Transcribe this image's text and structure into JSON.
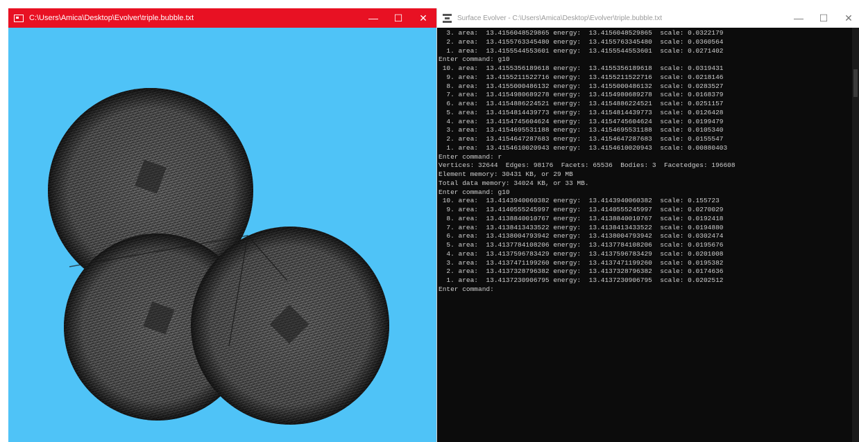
{
  "graphics_window": {
    "title": "C:\\Users\\Amica\\Desktop\\Evolver\\triple.bubble.txt",
    "background": "#4fc3f7",
    "titlebar_color": "#e81123",
    "controls": {
      "minimize": "—",
      "maximize": "☐",
      "close": "✕"
    }
  },
  "console_window": {
    "title": "Surface Evolver - C:\\Users\\Amica\\Desktop\\Evolver\\triple.bubble.txt",
    "controls": {
      "minimize": "—",
      "maximize": "☐",
      "close": "✕"
    },
    "lines": [
      "  3. area:  13.4156048529865 energy:  13.4156048529865  scale: 0.0322179",
      "  2. area:  13.4155763345480 energy:  13.4155763345480  scale: 0.0360564",
      "  1. area:  13.4155544553601 energy:  13.4155544553601  scale: 0.0271402",
      "Enter command: g10",
      " 10. area:  13.4155356189618 energy:  13.4155356189618  scale: 0.0319431",
      "  9. area:  13.4155211522716 energy:  13.4155211522716  scale: 0.0218146",
      "  8. area:  13.4155000486132 energy:  13.4155000486132  scale: 0.0283527",
      "  7. area:  13.4154980689278 energy:  13.4154980689278  scale: 0.0168379",
      "  6. area:  13.4154886224521 energy:  13.4154886224521  scale: 0.0251157",
      "  5. area:  13.4154814439773 energy:  13.4154814439773  scale: 0.0126428",
      "  4. area:  13.4154745604624 energy:  13.4154745604624  scale: 0.0199479",
      "  3. area:  13.4154695531188 energy:  13.4154695531188  scale: 0.0105340",
      "  2. area:  13.4154647287683 energy:  13.4154647287683  scale: 0.0155547",
      "  1. area:  13.4154610020943 energy:  13.4154610020943  scale: 0.00880403",
      "Enter command: r",
      "Vertices: 32644  Edges: 98176  Facets: 65536  Bodies: 3  Facetedges: 196608",
      "Element memory: 30431 KB, or 29 MB",
      "Total data memory: 34024 KB, or 33 MB.",
      "Enter command: g10",
      " 10. area:  13.4143940060382 energy:  13.4143940060382  scale: 0.155723",
      "  9. area:  13.4140555245997 energy:  13.4140555245997  scale: 0.0270029",
      "  8. area:  13.4138840010767 energy:  13.4138840010767  scale: 0.0192418",
      "  7. area:  13.4138413433522 energy:  13.4138413433522  scale: 0.0194880",
      "  6. area:  13.4138004793942 energy:  13.4138004793942  scale: 0.0302474",
      "  5. area:  13.4137784108206 energy:  13.4137784108206  scale: 0.0195676",
      "  4. area:  13.4137596783429 energy:  13.4137596783429  scale: 0.0201008",
      "  3. area:  13.4137471199260 energy:  13.4137471199260  scale: 0.0195382",
      "  2. area:  13.4137328796382 energy:  13.4137328796382  scale: 0.0174636",
      "  1. area:  13.4137230906795 energy:  13.4137230906795  scale: 0.0202512",
      "Enter command: "
    ]
  }
}
